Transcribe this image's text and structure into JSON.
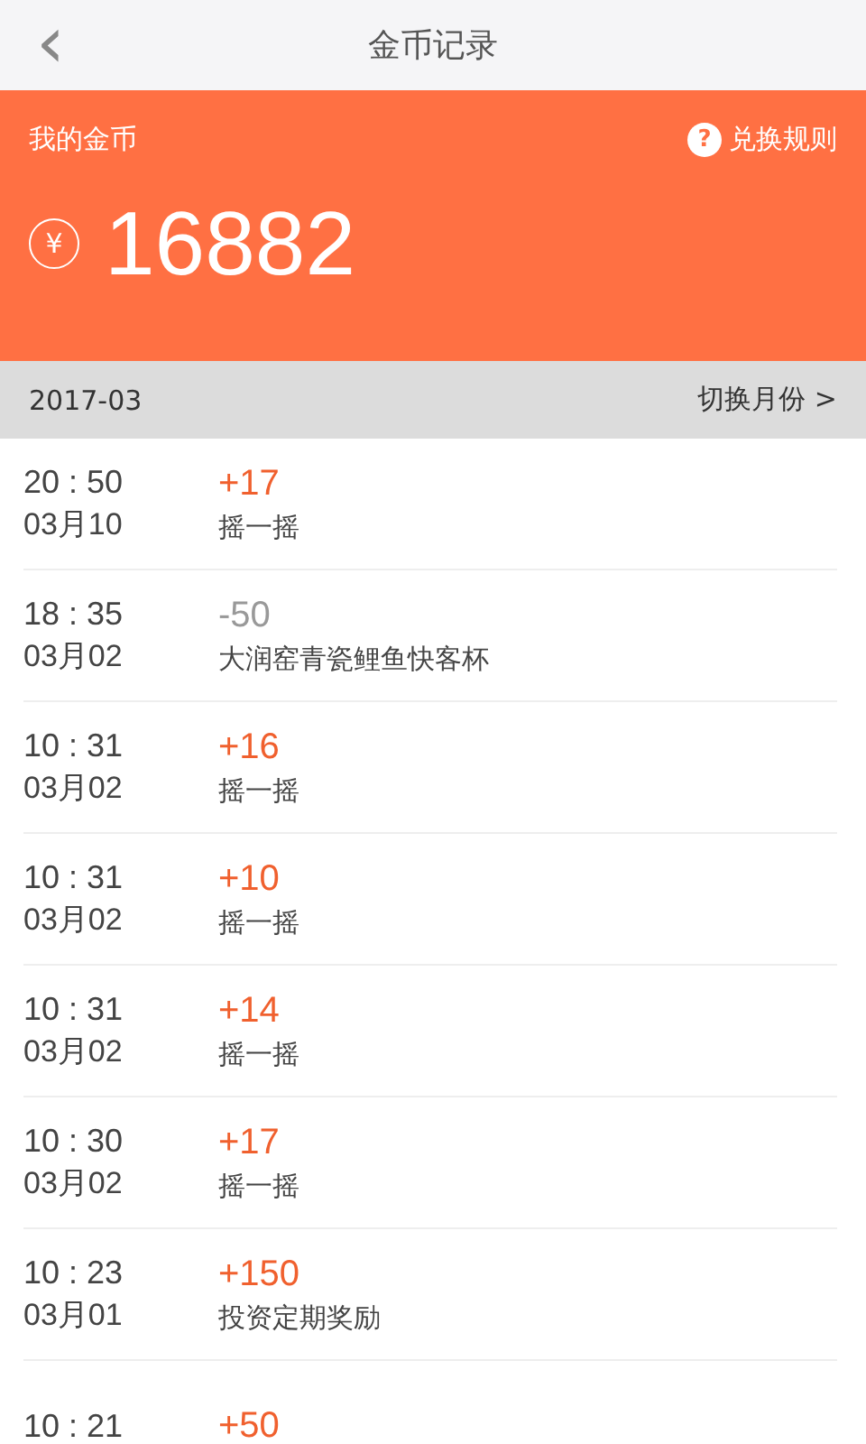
{
  "nav": {
    "back": "‹",
    "title": "金币记录"
  },
  "balance": {
    "label": "我的金币",
    "rules_icon": "?",
    "rules": "兑换规则",
    "currency": "¥",
    "amount": "16882"
  },
  "month_bar": {
    "month": "2017-03",
    "switch": "切换月份 >"
  },
  "records": [
    {
      "time": "20 : 50",
      "date": "03月10",
      "amount": "+17",
      "kind": "gain",
      "desc": "摇一摇"
    },
    {
      "time": "18 : 35",
      "date": "03月02",
      "amount": "-50",
      "kind": "spend",
      "desc": "大润窑青瓷鲤鱼快客杯"
    },
    {
      "time": "10 : 31",
      "date": "03月02",
      "amount": "+16",
      "kind": "gain",
      "desc": "摇一摇"
    },
    {
      "time": "10 : 31",
      "date": "03月02",
      "amount": "+10",
      "kind": "gain",
      "desc": "摇一摇"
    },
    {
      "time": "10 : 31",
      "date": "03月02",
      "amount": "+14",
      "kind": "gain",
      "desc": "摇一摇"
    },
    {
      "time": "10 : 30",
      "date": "03月02",
      "amount": "+17",
      "kind": "gain",
      "desc": "摇一摇"
    },
    {
      "time": "10 : 23",
      "date": "03月01",
      "amount": "+150",
      "kind": "gain",
      "desc": "投资定期奖励"
    },
    {
      "time": "10 : 21",
      "amount": "+50",
      "kind": "gain"
    }
  ]
}
